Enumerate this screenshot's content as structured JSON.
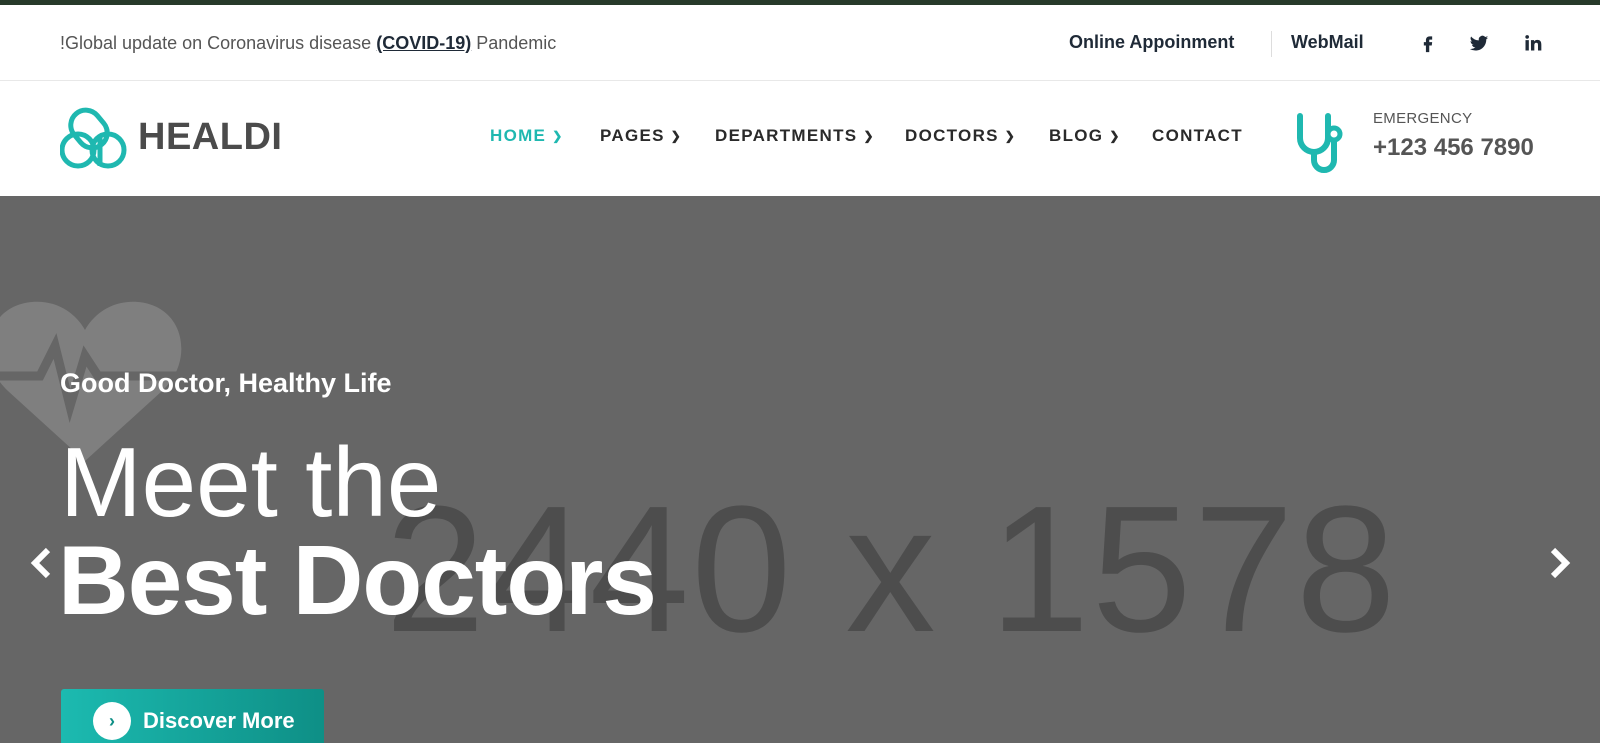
{
  "topbar": {
    "notice_prefix": "!Global update on Coronavirus disease ",
    "notice_link": "(COVID-19)",
    "notice_suffix": " Pandemic",
    "appointment_label": "Online Appoinment",
    "webmail_label": "WebMail",
    "social": [
      "facebook-icon",
      "twitter-icon",
      "linkedin-icon"
    ]
  },
  "header": {
    "logo_text": "HEALDI",
    "nav": [
      {
        "label": "HOME",
        "dropdown": true,
        "active": true
      },
      {
        "label": "PAGES",
        "dropdown": true
      },
      {
        "label": "DEPARTMENTS",
        "dropdown": true
      },
      {
        "label": "DOCTORS",
        "dropdown": true
      },
      {
        "label": "BLOG",
        "dropdown": true
      },
      {
        "label": "CONTACT",
        "dropdown": false
      }
    ],
    "emergency_label": "EMERGENCY",
    "emergency_phone": "+123 456 7890"
  },
  "hero": {
    "placeholder": "2440 x 1578",
    "subtitle": "Good Doctor, Healthy Life",
    "title_line1": "Meet the",
    "title_line2": "Best Doctors",
    "cta_label": "Discover More",
    "cta_icon": "chevron-right-icon"
  },
  "colors": {
    "accent": "#1fb8b0",
    "dark_text": "#1f2a37",
    "hero_bg": "#666666",
    "top_strip": "#273a2a"
  }
}
